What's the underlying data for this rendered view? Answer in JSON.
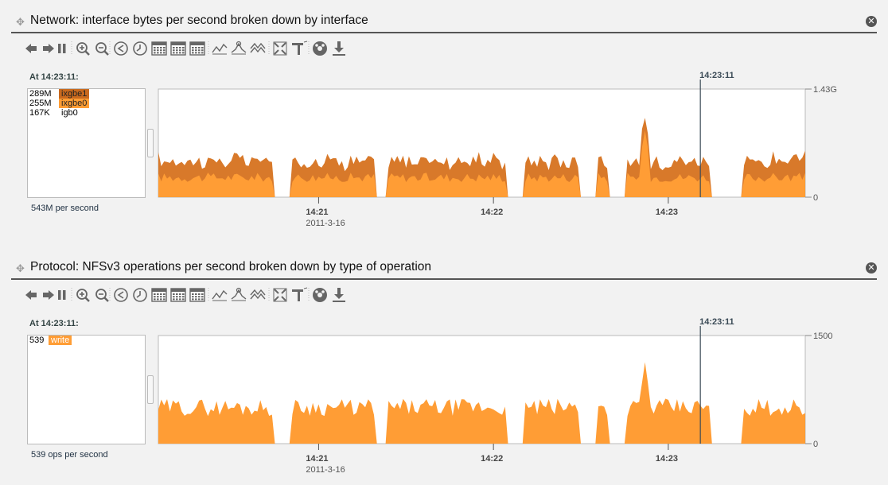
{
  "colors": {
    "write": "#ff9d35",
    "ixgbe1": "#d8792a",
    "ixgbe0": "#ff9d35",
    "panel_bg": "#f2f2f2",
    "cursor": "#3b4b57"
  },
  "panels": [
    {
      "title": "Network: interface bytes per second broken down by interface",
      "legend_at": "At 14:23:11:",
      "legend": [
        {
          "value": "289M",
          "name": "ixgbe1",
          "color": "#c8691e",
          "text_color": "#222"
        },
        {
          "value": "255M",
          "name": "ixgbe0",
          "color": "#ff9d35",
          "text_color": "#222"
        },
        {
          "value": "167K",
          "name": "igb0",
          "color": "",
          "text_color": "#000"
        }
      ],
      "summary": "543M per second",
      "y_max_label": "1.43G",
      "y_min_label": "0",
      "cursor_label": "14:23:11",
      "x_ticks": [
        {
          "label": "14:21",
          "sub": "2011-3-16"
        },
        {
          "label": "14:22",
          "sub": ""
        },
        {
          "label": "14:23",
          "sub": ""
        }
      ]
    },
    {
      "title": "Protocol: NFSv3 operations per second broken down by type of operation",
      "legend_at": "At 14:23:11:",
      "legend": [
        {
          "value": "539",
          "name": "write",
          "color": "#ff9d35",
          "text_color": "#fff"
        }
      ],
      "summary": "539 ops per second",
      "y_max_label": "1500",
      "y_min_label": "0",
      "cursor_label": "14:23:11",
      "x_ticks": [
        {
          "label": "14:21",
          "sub": "2011-3-16"
        },
        {
          "label": "14:22",
          "sub": ""
        },
        {
          "label": "14:23",
          "sub": ""
        }
      ]
    }
  ],
  "toolbar_icons": [
    "back-icon",
    "forward-icon",
    "pause-icon",
    "zoom-in-icon",
    "zoom-out-icon",
    "rewind-icon",
    "clock-icon",
    "calendar-minute-icon",
    "calendar-hour-icon",
    "calendar-day-icon",
    "line-icon",
    "peak-icon",
    "multi-line-icon",
    "fullscreen-icon",
    "drilldown-icon",
    "settings-icon",
    "download-icon"
  ],
  "chart_data": [
    {
      "type": "area",
      "title": "Network: interface bytes per second broken down by interface",
      "xlabel": "",
      "ylabel": "",
      "ylim": [
        0,
        1430000000
      ],
      "x_ticks": [
        "14:21",
        "14:22",
        "14:23"
      ],
      "x_date": "2011-3-16",
      "cursor_time": "14:23:11",
      "time_range": [
        "14:20:05",
        "14:23:47"
      ],
      "series": [
        {
          "name": "ixgbe0",
          "value_at_cursor": 255000000,
          "approx_level": 250000000,
          "spike": {
            "time": "14:22:52",
            "value": 880000000
          },
          "gaps": [
            [
              "14:20:45",
              "14:20:50"
            ],
            [
              "14:21:20",
              "14:21:23"
            ],
            [
              "14:22:05",
              "14:22:10"
            ],
            [
              "14:22:30",
              "14:22:35"
            ],
            [
              "14:22:40",
              "14:22:45"
            ],
            [
              "14:23:15",
              "14:23:25"
            ]
          ]
        },
        {
          "name": "ixgbe1",
          "value_at_cursor": 289000000,
          "approx_level": 230000000
        },
        {
          "name": "igb0",
          "value_at_cursor": 167000
        }
      ]
    },
    {
      "type": "area",
      "title": "Protocol: NFSv3 operations per second broken down by type of operation",
      "xlabel": "",
      "ylabel": "",
      "ylim": [
        0,
        1500
      ],
      "x_ticks": [
        "14:21",
        "14:22",
        "14:23"
      ],
      "x_date": "2011-3-16",
      "cursor_time": "14:23:11",
      "time_range": [
        "14:20:05",
        "14:23:47"
      ],
      "series": [
        {
          "name": "write",
          "value_at_cursor": 539,
          "approx_level": 480,
          "spike": {
            "time": "14:22:52",
            "value": 1130
          },
          "gaps": [
            [
              "14:20:45",
              "14:20:50"
            ],
            [
              "14:21:20",
              "14:21:23"
            ],
            [
              "14:22:05",
              "14:22:10"
            ],
            [
              "14:22:30",
              "14:22:35"
            ],
            [
              "14:22:40",
              "14:22:45"
            ],
            [
              "14:23:15",
              "14:23:25"
            ]
          ]
        }
      ]
    }
  ]
}
